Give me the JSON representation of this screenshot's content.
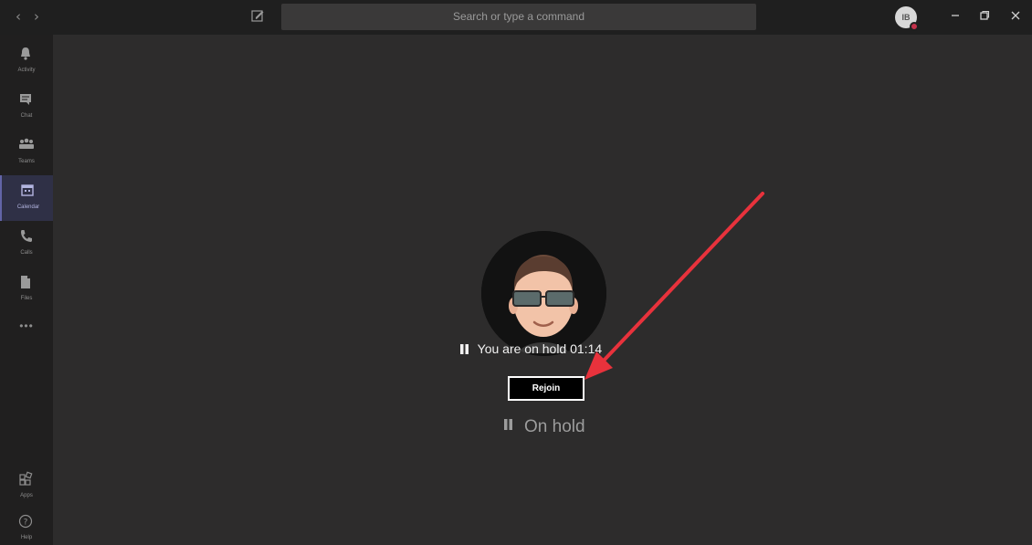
{
  "titlebar": {
    "back_icon": "chevron-left-icon",
    "forward_icon": "chevron-right-icon",
    "compose_icon": "compose-icon",
    "search_placeholder": "Search or type a command",
    "avatar_initials": "IB",
    "presence_color": "#c4314b",
    "minimize_icon": "minimize-icon",
    "restore_icon": "restore-icon",
    "close_icon": "close-icon"
  },
  "rail": {
    "items": [
      {
        "label": "Activity",
        "icon": "bell-icon"
      },
      {
        "label": "Chat",
        "icon": "chat-icon"
      },
      {
        "label": "Teams",
        "icon": "teams-icon"
      },
      {
        "label": "Calendar",
        "icon": "calendar-icon",
        "active": true
      },
      {
        "label": "Calls",
        "icon": "phone-icon"
      },
      {
        "label": "Files",
        "icon": "files-icon"
      }
    ],
    "more": "•••",
    "bottom": [
      {
        "label": "Apps",
        "icon": "apps-icon"
      },
      {
        "label": "Help",
        "icon": "help-icon"
      }
    ]
  },
  "call": {
    "hold_text": "You are on hold",
    "hold_time": "01:14",
    "rejoin_label": "Rejoin",
    "on_hold_label": "On hold"
  },
  "annotation": {
    "arrow_color": "#e8323c"
  },
  "colors": {
    "stage_bg": "#2d2c2c",
    "rail_bg": "#201f1f",
    "accent": "#6264a7"
  }
}
